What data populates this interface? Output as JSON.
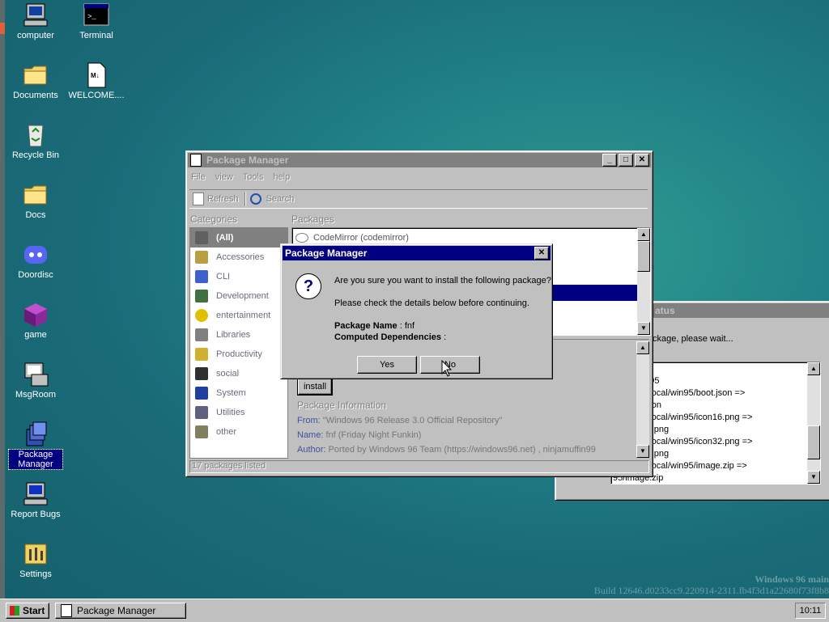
{
  "desktop": {
    "icons": [
      {
        "label": "computer",
        "icon": "computer-icon"
      },
      {
        "label": "Terminal",
        "icon": "terminal-icon"
      },
      {
        "label": "Documents",
        "icon": "folder-icon"
      },
      {
        "label": "WELCOME....",
        "icon": "markdown-file-icon"
      },
      {
        "label": "Recycle Bin",
        "icon": "recycle-bin-icon"
      },
      {
        "label": "Docs",
        "icon": "folder-icon"
      },
      {
        "label": "Doordisc",
        "icon": "discord-icon"
      },
      {
        "label": "game",
        "icon": "cube-icon"
      },
      {
        "label": "MsgRoom",
        "icon": "msgroom-icon"
      },
      {
        "label": "Package Manager",
        "icon": "package-icon"
      },
      {
        "label": "Report Bugs",
        "icon": "bug-report-icon"
      },
      {
        "label": "Settings",
        "icon": "settings-icon"
      }
    ],
    "watermark": {
      "line1": "Windows 96 main",
      "line2": "Build 12646.d0233cc9.220914-2311.fb4f3d1a22680f73f8b8"
    }
  },
  "package_manager": {
    "title": "Package Manager",
    "menu": [
      "File",
      "view",
      "Tools",
      "help"
    ],
    "toolbar": {
      "refresh": "Refresh",
      "search": "Search"
    },
    "categories_header": "Categories",
    "packages_header": "Packages",
    "categories": [
      "(All)",
      "Accessories",
      "CLI",
      "Development",
      "entertainment",
      "Libraries",
      "Productivity",
      "social",
      "System",
      "Utilities",
      "other"
    ],
    "package_list_top": "CodeMirror (codemirror)",
    "install_button": "install",
    "info_title": "Package Information",
    "info": {
      "from_label": "From:",
      "from_value": "\"Windows 96 Release 3.0 Official Repository\"",
      "name_label": "Name:",
      "name_value": "fnf (Friday Night Funkin)",
      "author_label": "Author:",
      "author_value": "Ported by Windows 96 Team (https://windows96.net) , ninjamuffin99"
    },
    "status": "17 packages listed"
  },
  "status_window": {
    "title": "atus",
    "message": "ckage, please wait...",
    "log": [
      "/conv2crlf",
      "/local/win95",
      "ack /root/local/win95/boot.json =>",
      "95/boot.json",
      "ack /root/local/win95/icon16.png =>",
      "95/icon16.png",
      "ack /root/local/win95/icon32.png =>",
      "95/icon32.png",
      "ack /root/local/win95/image.zip =>",
      "95/image.zip"
    ]
  },
  "dialog": {
    "title": "Package Manager",
    "question": "Are you sure you want to install the following package?",
    "note": "Please check the details below before continuing.",
    "pkg_name_label": "Package Name",
    "pkg_name_value": ": fnf",
    "deps_label": "Computed Dependencies",
    "deps_value": ":",
    "yes": "Yes",
    "no": "No"
  },
  "taskbar": {
    "start": "Start",
    "task": "Package Manager",
    "clock": "10:11"
  },
  "colors": {
    "desktop": "#1f7f86",
    "title_active": "#000080",
    "face": "#c0c0c0"
  }
}
